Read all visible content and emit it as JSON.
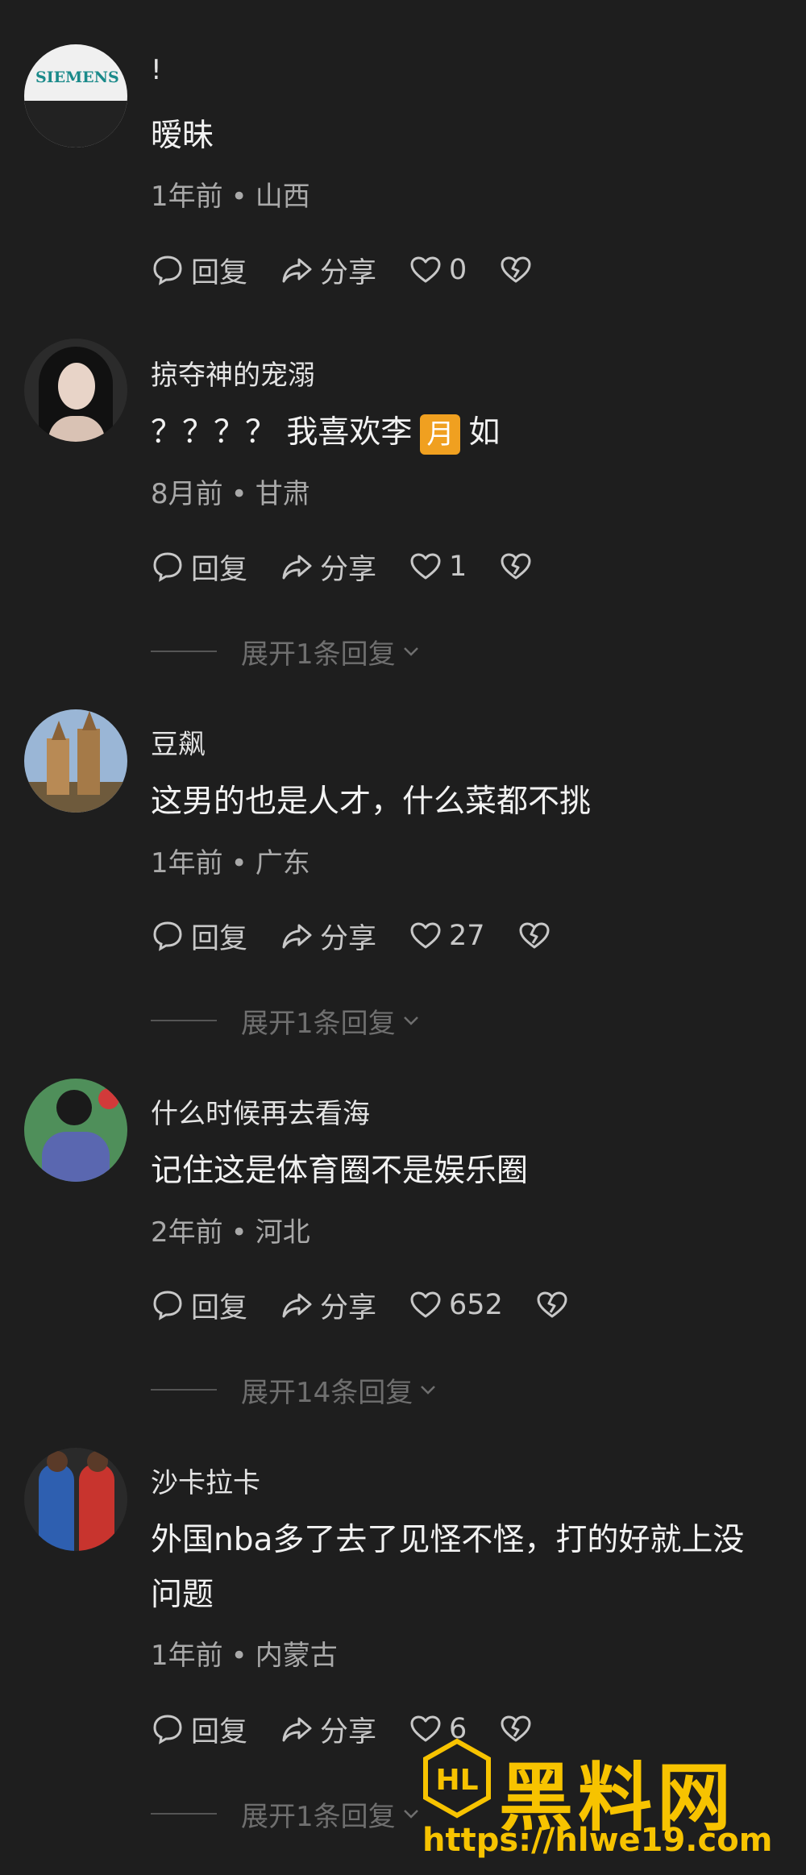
{
  "labels": {
    "reply": "回复",
    "share": "分享"
  },
  "comments": [
    {
      "username": "!",
      "text": "暧昧",
      "time": "1年前",
      "location": "山西",
      "likes": "0"
    },
    {
      "username": "掠夺神的宠溺",
      "text_before": "？？？？ 我喜欢李",
      "text_emoji": "月",
      "text_after": "如",
      "time": "8月前",
      "location": "甘肃",
      "likes": "1",
      "expand": "展开1条回复"
    },
    {
      "username": "豆飙",
      "text": "这男的也是人才，什么菜都不挑",
      "time": "1年前",
      "location": "广东",
      "likes": "27",
      "expand": "展开1条回复"
    },
    {
      "username": "什么时候再去看海",
      "text": "记住这是体育圈不是娱乐圈",
      "time": "2年前",
      "location": "河北",
      "likes": "652",
      "expand": "展开14条回复"
    },
    {
      "username": "沙卡拉卡",
      "text_line1": "外国nba多了去了见怪不怪，打的好就上没",
      "text_line2": "问题",
      "time": "1年前",
      "location": "内蒙古",
      "likes": "6",
      "expand": "展开1条回复"
    }
  ],
  "avatars": {
    "c0_logo": "SIEMENS"
  },
  "watermark": {
    "title": "黑料网",
    "url": "https://hlwe19.com",
    "logo_letters": "HL"
  },
  "colors": {
    "background": "#1e1e1e",
    "watermark": "#f7c300",
    "emoji_bg": "#f0a020"
  }
}
